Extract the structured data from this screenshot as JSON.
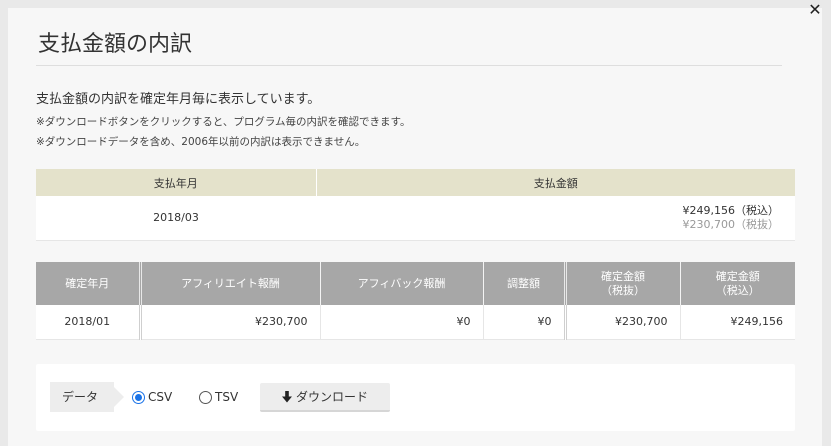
{
  "modal": {
    "title": "支払金額の内訳",
    "lead": "支払金額の内訳を確定年月毎に表示しています。",
    "notes": [
      "※ダウンロードボタンをクリックすると、プログラム毎の内訳を確認できます。",
      "※ダウンロードデータを含め、2006年以前の内訳は表示できません。"
    ]
  },
  "summary": {
    "headers": [
      "支払年月",
      "支払金額"
    ],
    "row": {
      "month": "2018/03",
      "amount_incl": "¥249,156（税込）",
      "amount_excl": "¥230,700（税抜）"
    }
  },
  "detail": {
    "headers": [
      "確定年月",
      "アフィリエイト報酬",
      "アフィバック報酬",
      "調整額",
      "確定金額\n（税抜）",
      "確定金額\n（税込）"
    ],
    "header_lines": [
      [
        "確定年月"
      ],
      [
        "アフィリエイト報酬"
      ],
      [
        "アフィバック報酬"
      ],
      [
        "調整額"
      ],
      [
        "確定金額",
        "（税抜）"
      ],
      [
        "確定金額",
        "（税込）"
      ]
    ],
    "rows": [
      [
        "2018/01",
        "¥230,700",
        "¥0",
        "¥0",
        "¥230,700",
        "¥249,156"
      ]
    ]
  },
  "export": {
    "label": "データ",
    "options": [
      {
        "label": "CSV",
        "checked": true
      },
      {
        "label": "TSV",
        "checked": false
      }
    ],
    "download_label": "ダウンロード"
  },
  "icons": {
    "close": "close-icon",
    "download": "arrow-down-icon"
  },
  "colors": {
    "summary_header": "#e4e2cb",
    "detail_header": "#a7a7a7",
    "radio_accent": "#1a73e8"
  }
}
